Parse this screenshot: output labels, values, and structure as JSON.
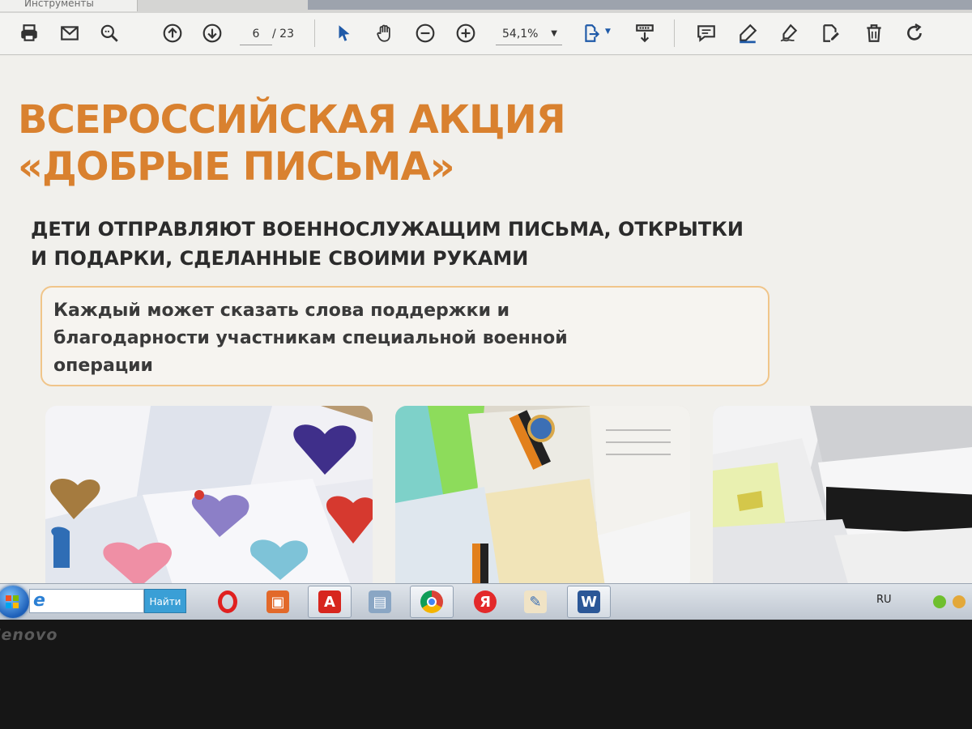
{
  "tabs": {
    "tools_label": "Инструменты"
  },
  "toolbar": {
    "page_current": "6",
    "page_total": "/ 23",
    "zoom": "54,1%",
    "icons": [
      "print-icon",
      "mail-icon",
      "search-icon",
      "arrow-up-icon",
      "arrow-down-icon",
      "cursor-icon",
      "hand-icon",
      "zoom-out-icon",
      "zoom-in-icon",
      "fit-page-icon",
      "download-icon",
      "comment-icon",
      "highlight-icon",
      "sign-icon",
      "edit-icon",
      "trash-icon",
      "rotate-icon"
    ],
    "accent": "#1f5aa8"
  },
  "document": {
    "title_line1": "ВСЕРОССИЙСКАЯ АКЦИЯ",
    "title_line2": "«ДОБРЫЕ ПИСЬМА»",
    "subtitle_line1": "ДЕТИ ОТПРАВЛЯЮТ ВОЕННОСЛУЖАЩИМ ПИСЬМА, ОТКРЫТКИ",
    "subtitle_line2": "И ПОДАРКИ, СДЕЛАННЫЕ СВОИМИ РУКАМИ",
    "quote_line1": "Каждый может сказать слова поддержки и",
    "quote_line2": "благодарности участникам специальной военной",
    "quote_line3": "операции",
    "title_color": "#d9812f",
    "box_border_color": "#f0c58a"
  },
  "taskbar": {
    "search_button": "Найти",
    "language": "RU",
    "apps": [
      "opera-icon",
      "powerpoint-icon",
      "acrobat-icon",
      "printer-icon",
      "chrome-icon",
      "yandex-icon",
      "paint-icon",
      "word-icon"
    ]
  },
  "bezel": {
    "brand": "lenovo"
  }
}
